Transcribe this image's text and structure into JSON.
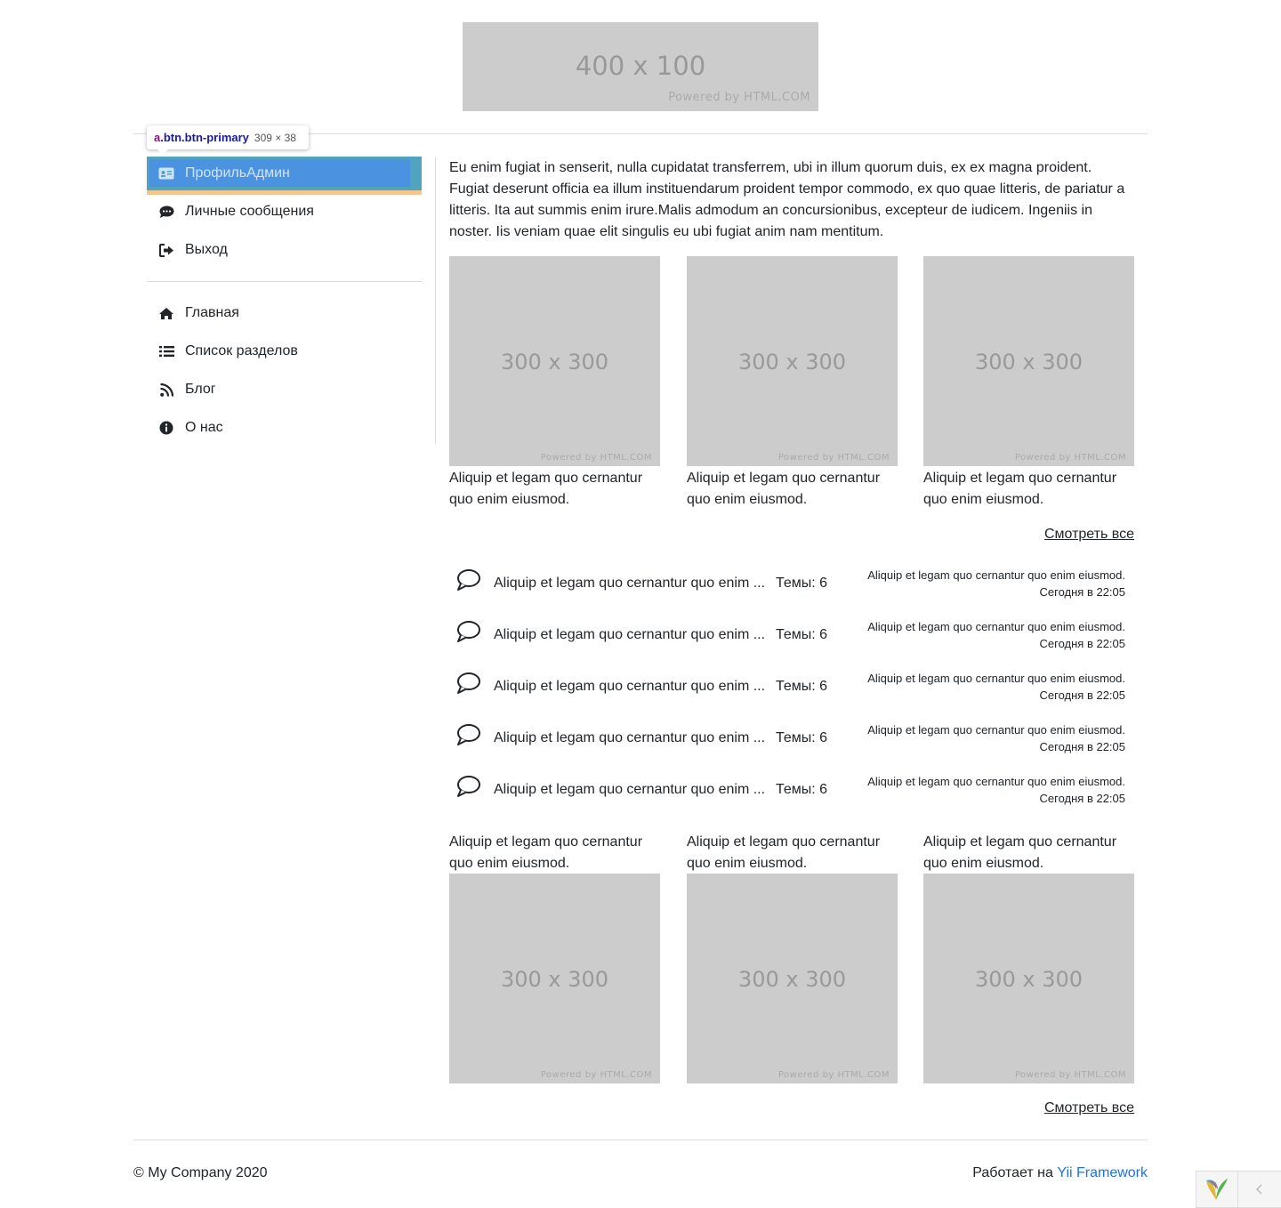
{
  "header": {
    "logo": {
      "size_label": "400 x 100",
      "powered": "Powered by HTML.COM"
    }
  },
  "inspector_tooltip": {
    "tag": "a",
    "classes": ".btn.btn-primary",
    "dims": "309 × 38"
  },
  "sidebar": {
    "user_items": [
      {
        "label": "ПрофильАдмин",
        "icon": "id-card-icon"
      },
      {
        "label": "Личные сообщения",
        "icon": "comment-dots-icon"
      },
      {
        "label": "Выход",
        "icon": "sign-out-icon"
      }
    ],
    "nav_items": [
      {
        "label": "Главная",
        "icon": "home-icon"
      },
      {
        "label": "Список разделов",
        "icon": "list-icon"
      },
      {
        "label": "Блог",
        "icon": "rss-icon"
      },
      {
        "label": "О нас",
        "icon": "info-circle-icon"
      }
    ]
  },
  "main": {
    "intro": "Eu enim fugiat in senserit, nulla cupidatat transferrem, ubi in illum quorum duis, ex ex magna proident. Fugiat deserunt officia ea illum instituendarum proident tempor commodo, ex quo quae litteris, de pariatur a litteris. Ita aut summis enim irure.Malis admodum an concursionibus, excepteur de iudicem. Ingeniis in noster. Iis veniam quae elit singulis eu ubi fugiat anim nam mentitum.",
    "gallery_top": [
      {
        "size_label": "300 x 300",
        "powered": "Powered by HTML.COM",
        "caption": "Aliquip et legam quo cernantur quo enim eiusmod."
      },
      {
        "size_label": "300 x 300",
        "powered": "Powered by HTML.COM",
        "caption": "Aliquip et legam quo cernantur quo enim eiusmod."
      },
      {
        "size_label": "300 x 300",
        "powered": "Powered by HTML.COM",
        "caption": "Aliquip et legam quo cernantur quo enim eiusmod."
      }
    ],
    "see_all_1": "Смотреть все",
    "forum_rows": [
      {
        "title": "Aliquip et legam quo cernantur quo enim ...",
        "topics": "Темы: 6",
        "last_post": "Aliquip et legam quo cernantur quo enim eiusmod.",
        "last_time": "Сегодня в 22:05"
      },
      {
        "title": "Aliquip et legam quo cernantur quo enim ...",
        "topics": "Темы: 6",
        "last_post": "Aliquip et legam quo cernantur quo enim eiusmod.",
        "last_time": "Сегодня в 22:05"
      },
      {
        "title": "Aliquip et legam quo cernantur quo enim ...",
        "topics": "Темы: 6",
        "last_post": "Aliquip et legam quo cernantur quo enim eiusmod.",
        "last_time": "Сегодня в 22:05"
      },
      {
        "title": "Aliquip et legam quo cernantur quo enim ...",
        "topics": "Темы: 6",
        "last_post": "Aliquip et legam quo cernantur quo enim eiusmod.",
        "last_time": "Сегодня в 22:05"
      },
      {
        "title": "Aliquip et legam quo cernantur quo enim ...",
        "topics": "Темы: 6",
        "last_post": "Aliquip et legam quo cernantur quo enim eiusmod.",
        "last_time": "Сегодня в 22:05"
      }
    ],
    "gallery_bottom": [
      {
        "size_label": "300 x 300",
        "powered": "Powered by HTML.COM",
        "caption": "Aliquip et legam quo cernantur quo enim eiusmod."
      },
      {
        "size_label": "300 x 300",
        "powered": "Powered by HTML.COM",
        "caption": "Aliquip et legam quo cernantur quo enim eiusmod."
      },
      {
        "size_label": "300 x 300",
        "powered": "Powered by HTML.COM",
        "caption": "Aliquip et legam quo cernantur quo enim eiusmod."
      }
    ],
    "see_all_2": "Смотреть все"
  },
  "footer": {
    "copyright": "© My Company 2020",
    "powered_prefix": "Работает на",
    "powered_link": "Yii Framework"
  },
  "colors": {
    "accent": "#50a4bd",
    "link": "#1a73e8",
    "placeholder": "#cccccc"
  }
}
